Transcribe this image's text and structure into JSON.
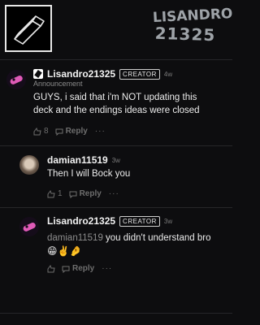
{
  "header": {
    "logo_line1": "LISANDRO",
    "logo_line2": "21325"
  },
  "comments": [
    {
      "username": "Lisandro21325",
      "badge": "CREATOR",
      "time": "4w",
      "sub_label": "Announcement",
      "text_line1": "GUYS, i said that i'm NOT updating this",
      "text_line2": "deck and the endings ideas were closed",
      "like_count": "8",
      "reply_label": "Reply",
      "more_label": "···"
    },
    {
      "username": "damian11519",
      "time": "3w",
      "text_line1": "Then I will Bock you",
      "like_count": "1",
      "reply_label": "Reply",
      "more_label": "···"
    },
    {
      "username": "Lisandro21325",
      "badge": "CREATOR",
      "time": "3w",
      "mention": "damian11519",
      "text_rest": " you didn't understand bro",
      "emojis": "😁✌️🤌",
      "reply_label": "Reply",
      "more_label": "···"
    }
  ],
  "colors": {
    "background": "#0d0d0f",
    "muted": "#6e6e6e",
    "accent_avatar": "#e05ab8"
  }
}
